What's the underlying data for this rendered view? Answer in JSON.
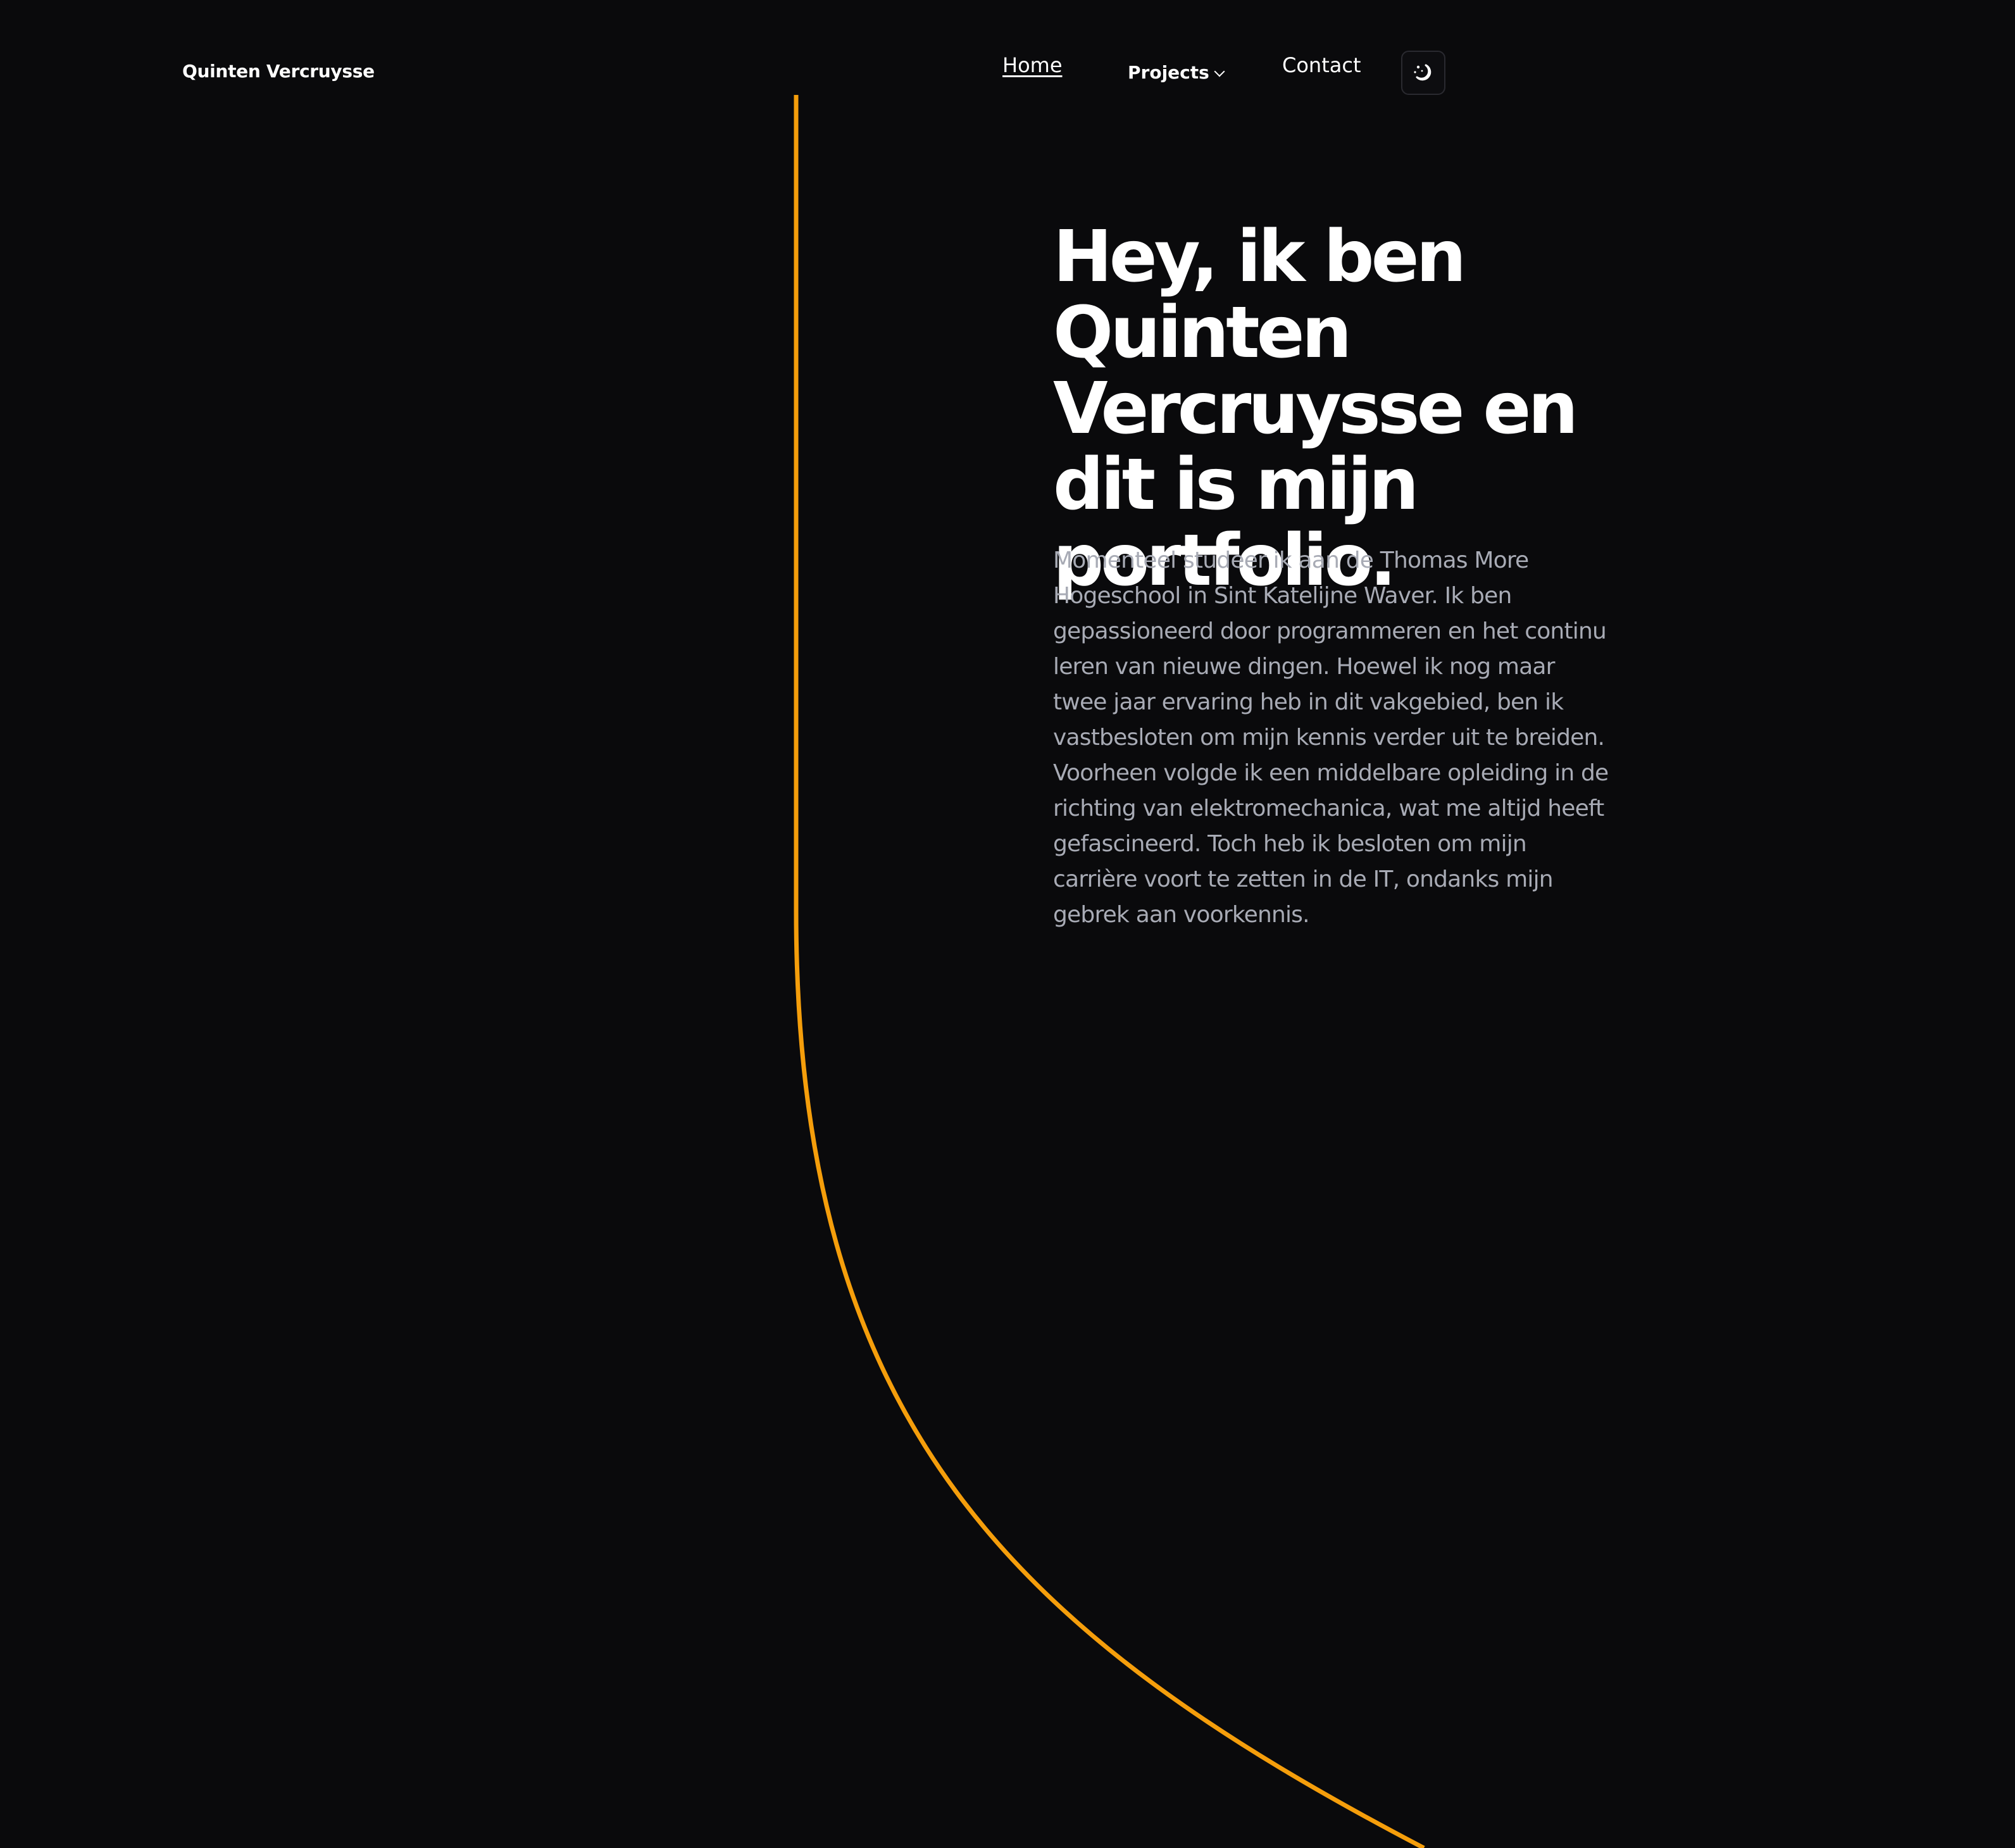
{
  "header": {
    "brand": "Quinten Vercruysse",
    "nav": {
      "home": "Home",
      "projects": "Projects",
      "contact": "Contact"
    },
    "theme_toggle_icon": "moon-stars-icon"
  },
  "hero": {
    "title": "Hey, ik ben Quinten Vercruysse en dit is mijn portfolio.",
    "intro": "Momenteel studeer ik aan de Thomas More Hogeschool in Sint Katelijne Waver. Ik ben gepassioneerd door programmeren en het continu leren van nieuwe dingen. Hoewel ik nog maar twee jaar ervaring heb in dit vakgebied, ben ik vastbesloten om mijn kennis verder uit te breiden. Voorheen volgde ik een middelbare opleiding in de richting van elektromechanica, wat me altijd heeft gefascineerd. Toch heb ik besloten om mijn carrière voort te zetten in de IT, ondanks mijn gebrek aan voorkennis."
  },
  "colors": {
    "background": "#0a0a0c",
    "accent": "#f59e0b",
    "text": "#ffffff",
    "muted_text": "#a8abb5"
  }
}
